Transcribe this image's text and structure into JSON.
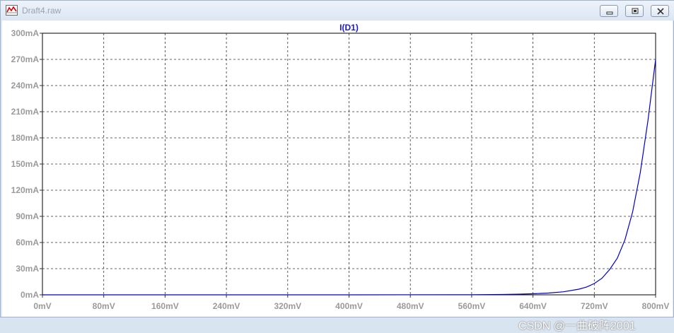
{
  "window": {
    "title": "Draft4.raw",
    "controls": [
      {
        "name": "minimize-button",
        "icon": "minimize-icon"
      },
      {
        "name": "restore-button",
        "icon": "restore-icon"
      },
      {
        "name": "close-button",
        "icon": "close-icon"
      }
    ]
  },
  "watermark": "CSDN @一曲破阵2001",
  "chart_data": {
    "type": "line",
    "title": "I(D1)",
    "xlabel": "",
    "ylabel": "",
    "xlim": [
      0,
      800
    ],
    "ylim": [
      0,
      300
    ],
    "x_ticks": [
      0,
      80,
      160,
      240,
      320,
      400,
      480,
      560,
      640,
      720,
      800
    ],
    "x_tick_labels": [
      "0mV",
      "80mV",
      "160mV",
      "240mV",
      "320mV",
      "400mV",
      "480mV",
      "560mV",
      "640mV",
      "720mV",
      "800mV"
    ],
    "y_ticks": [
      0,
      30,
      60,
      90,
      120,
      150,
      180,
      210,
      240,
      270,
      300
    ],
    "y_tick_labels": [
      "0mA",
      "30mA",
      "60mA",
      "90mA",
      "120mA",
      "150mA",
      "180mA",
      "210mA",
      "240mA",
      "270mA",
      "300mA"
    ],
    "grid": true,
    "line_color": "#0000c8",
    "series": [
      {
        "name": "I(D1)",
        "x": [
          0,
          400,
          560,
          600,
          620,
          640,
          660,
          680,
          700,
          710,
          720,
          730,
          740,
          750,
          760,
          770,
          780,
          790,
          800
        ],
        "y": [
          0,
          0,
          0.2,
          0.4,
          0.7,
          1.2,
          2,
          3.5,
          6.5,
          9,
          13,
          19,
          29,
          42,
          63,
          95,
          140,
          200,
          270
        ]
      }
    ]
  }
}
